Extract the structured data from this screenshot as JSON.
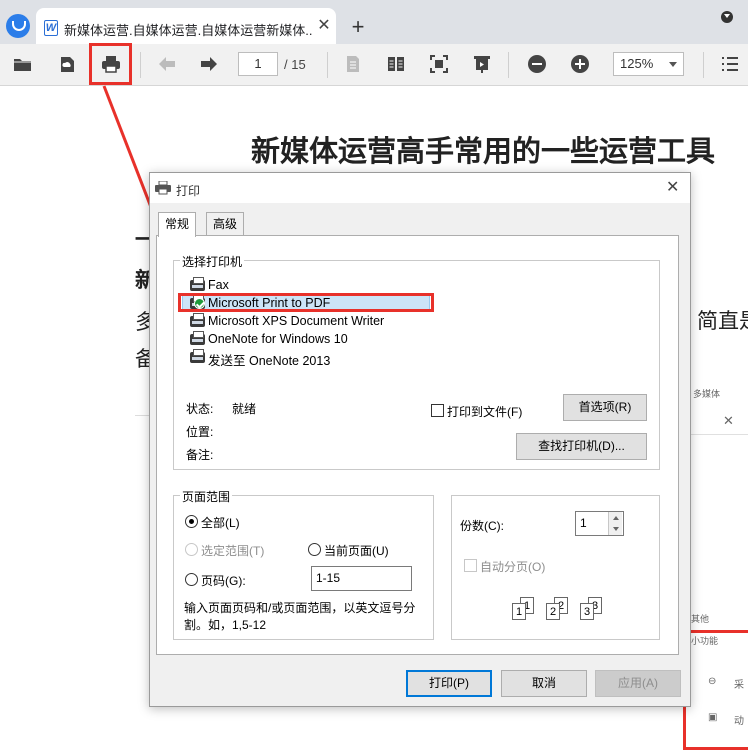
{
  "browser": {
    "tab_title": "新媒体运营.自媒体运营.自媒体运营新媒体...",
    "tab_close": "✕",
    "new_tab": "+"
  },
  "toolbar": {
    "page_current": "1",
    "page_total": "/ 15",
    "zoom": "125%",
    "icons": [
      "open-folder-icon",
      "cloud-save-icon",
      "print-icon",
      "prev-page-icon",
      "next-page-icon",
      "single-page-icon",
      "two-page-icon",
      "fit-page-icon",
      "presentation-icon",
      "zoom-out-icon",
      "zoom-in-icon",
      "menu-icon"
    ]
  },
  "document": {
    "title": "新媒体运营高手常用的一些运营工具",
    "fragments": [
      "一",
      "新",
      "多",
      "备",
      "简直是"
    ]
  },
  "side_panel": {
    "text1": "多媒体",
    "close": "✕",
    "text2": "其他",
    "text3": "小功能",
    "text4": "采",
    "text5": "动"
  },
  "dialog": {
    "title": "打印",
    "close": "✕",
    "tabs": [
      "常规",
      "高级"
    ],
    "select_printer_group": "选择打印机",
    "printers": [
      "Fax",
      "Microsoft Print to PDF",
      "Microsoft XPS Document Writer",
      "OneNote for Windows 10",
      "发送至 OneNote 2013"
    ],
    "selected_printer_index": 1,
    "status_label": "状态:",
    "status_value": "就绪",
    "location_label": "位置:",
    "comment_label": "备注:",
    "print_to_file": "打印到文件(F)",
    "preferences_button": "首选项(R)",
    "find_printer_button": "查找打印机(D)...",
    "page_range_group": "页面范围",
    "range_all": "全部(L)",
    "range_selection": "选定范围(T)",
    "range_current": "当前页面(U)",
    "range_pages": "页码(G):",
    "pages_value": "1-15",
    "pages_hint": "输入页面页码和/或页面范围，以英文逗号分割。如，1,5-12",
    "copies_label": "份数(C):",
    "copies_value": "1",
    "collate": "自动分页(O)",
    "collate_pages": [
      "1",
      "1",
      "2",
      "2",
      "3",
      "3"
    ],
    "print_button": "打印(P)",
    "cancel_button": "取消",
    "apply_button": "应用(A)"
  },
  "colors": {
    "highlight": "#e8312a",
    "selection": "#cce4f7",
    "primary_border": "#0078d7"
  }
}
